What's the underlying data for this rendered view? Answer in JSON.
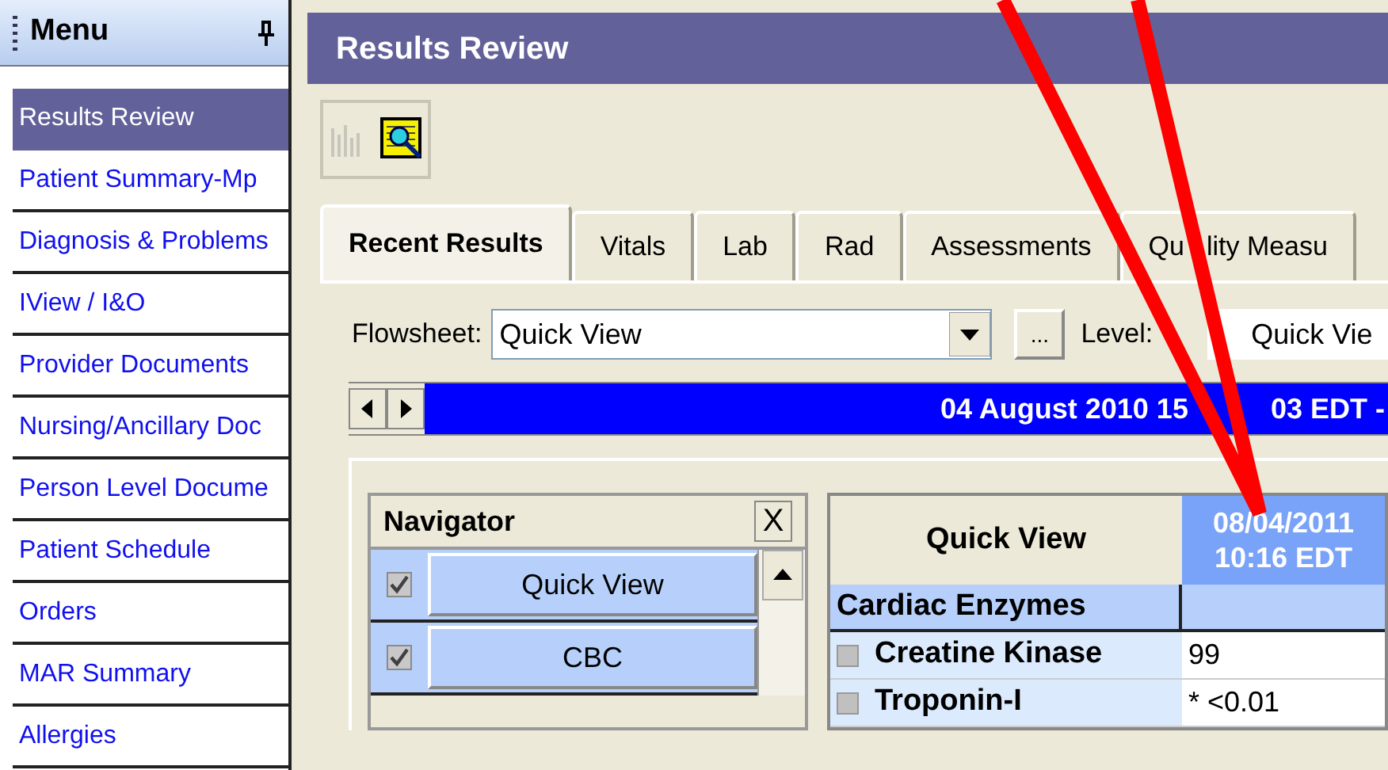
{
  "menu": {
    "title": "Menu",
    "items": [
      {
        "label": "Results Review",
        "selected": true
      },
      {
        "label": "Patient Summary-Mp",
        "selected": false
      },
      {
        "label": "Diagnosis & Problems",
        "selected": false
      },
      {
        "label": "IView / I&O",
        "selected": false
      },
      {
        "label": "Provider Documents",
        "selected": false
      },
      {
        "label": "Nursing/Ancillary Doc",
        "selected": false
      },
      {
        "label": "Person Level Docume",
        "selected": false
      },
      {
        "label": "Patient Schedule",
        "selected": false
      },
      {
        "label": "Orders",
        "selected": false
      },
      {
        "label": "MAR Summary",
        "selected": false
      },
      {
        "label": "Allergies",
        "selected": false
      }
    ]
  },
  "window": {
    "title": "Results Review"
  },
  "toolbar": [
    {
      "kind": "chart",
      "disabled": true
    },
    {
      "kind": "report",
      "disabled": false
    }
  ],
  "tabs": [
    {
      "label": "Recent Results",
      "selected": true
    },
    {
      "label": "Vitals",
      "selected": false
    },
    {
      "label": "Lab",
      "selected": false
    },
    {
      "label": "Rad",
      "selected": false
    },
    {
      "label": "Assessments",
      "selected": false
    },
    {
      "label": "Qu",
      "label_after": "lity Measu",
      "selected": false
    }
  ],
  "flowsheet": {
    "label": "Flowsheet:",
    "value": "Quick View",
    "browse": "...",
    "level_label": "Level:",
    "level_value": "Quick Vie"
  },
  "date_bar": {
    "text": "04 August 2010 15",
    "text_after": "03 EDT -"
  },
  "navigator": {
    "title": "Navigator",
    "close": "X",
    "items": [
      {
        "label": "Quick View",
        "checked": true
      },
      {
        "label": "CBC",
        "checked": true
      }
    ]
  },
  "grid": {
    "heading": "Quick View",
    "column_date": "08/04/2011",
    "column_time": "10:16 EDT",
    "section": "Cardiac Enzymes",
    "rows": [
      {
        "name": "Creatine Kinase",
        "value": "99"
      },
      {
        "name": "Troponin-I",
        "value": "* <0.01"
      }
    ]
  },
  "annotation": {
    "kind": "arrow"
  }
}
